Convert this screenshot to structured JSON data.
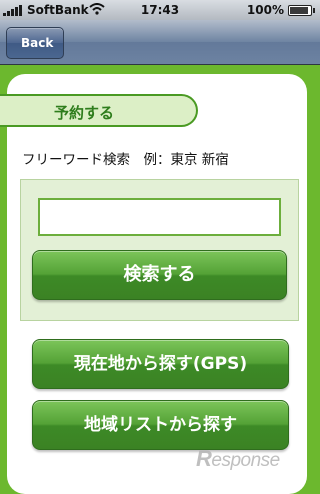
{
  "status_bar": {
    "carrier": "SoftBank",
    "time": "17:43",
    "battery_percent": "100%",
    "battery_level": 1.0,
    "wifi_icon": "wifi-icon"
  },
  "nav_bar": {
    "back_label": "Back"
  },
  "section": {
    "title": "予約する"
  },
  "freeword": {
    "label": "フリーワード検索　例：東京 新宿",
    "input_value": ""
  },
  "buttons": {
    "search": "検索する",
    "gps": "現在地から探す(GPS)",
    "region_list": "地域リストから探す"
  },
  "watermark": {
    "text": "Response",
    "logo_letter": "R",
    "logo_rest": "esponse"
  },
  "colors": {
    "background": "#6cb82e",
    "accent": "#2e7d1c",
    "button": "#54a236"
  }
}
